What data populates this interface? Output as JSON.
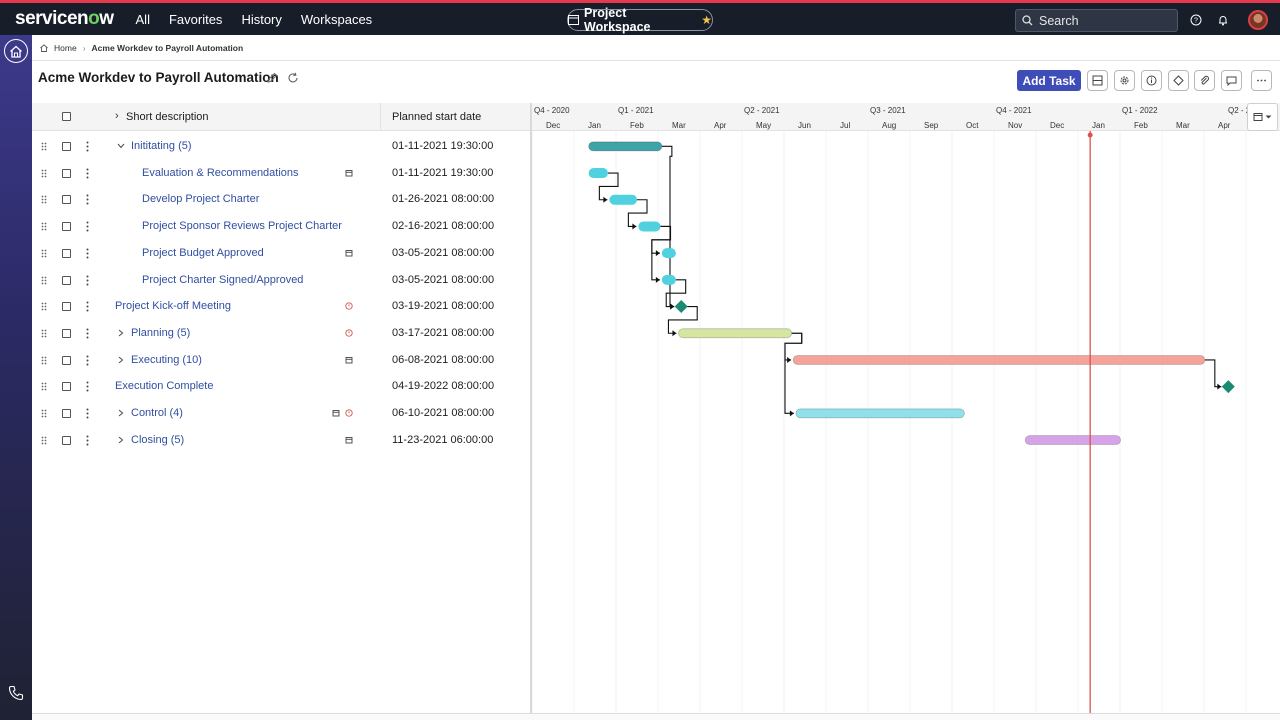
{
  "app": {
    "brand_pre": "servicen",
    "brand_o": "o",
    "brand_post": "w"
  },
  "nav": {
    "all": "All",
    "favorites": "Favorites",
    "history": "History",
    "workspaces": "Workspaces"
  },
  "workspace_pill": {
    "label": "Project Workspace"
  },
  "search": {
    "placeholder": "Search"
  },
  "breadcrumb": {
    "home": "Home",
    "current": "Acme Workdev to Payroll Automation"
  },
  "page": {
    "title": "Acme Workdev to Payroll Automation",
    "add_task": "Add Task"
  },
  "grid": {
    "col_description": "Short description",
    "col_start": "Planned start date",
    "rows": [
      {
        "label": "Inititating (5)",
        "date": "01-11-2021 19:30:00",
        "level": 1,
        "expander": "open",
        "indicators": []
      },
      {
        "label": "Evaluation & Recommendations",
        "date": "01-11-2021 19:30:00",
        "level": 2,
        "expander": "",
        "indicators": [
          "calendar"
        ]
      },
      {
        "label": "Develop Project Charter",
        "date": "01-26-2021 08:00:00",
        "level": 2,
        "expander": "",
        "indicators": []
      },
      {
        "label": "Project Sponsor Reviews Project Charter",
        "date": "02-16-2021 08:00:00",
        "level": 2,
        "expander": "",
        "indicators": []
      },
      {
        "label": "Project Budget Approved",
        "date": "03-05-2021 08:00:00",
        "level": 2,
        "expander": "",
        "indicators": [
          "calendar"
        ]
      },
      {
        "label": "Project Charter Signed/Approved",
        "date": "03-05-2021 08:00:00",
        "level": 2,
        "expander": "",
        "indicators": []
      },
      {
        "label": "Project Kick-off Meeting",
        "date": "03-19-2021 08:00:00",
        "level": 0,
        "expander": "",
        "indicators": [
          "alert"
        ]
      },
      {
        "label": "Planning (5)",
        "date": "03-17-2021 08:00:00",
        "level": 1,
        "expander": "closed",
        "indicators": [
          "alert"
        ]
      },
      {
        "label": "Executing (10)",
        "date": "06-08-2021 08:00:00",
        "level": 1,
        "expander": "closed",
        "indicators": [
          "calendar"
        ]
      },
      {
        "label": "Execution Complete",
        "date": "04-19-2022 08:00:00",
        "level": 0,
        "expander": "",
        "indicators": []
      },
      {
        "label": "Control (4)",
        "date": "06-10-2021 08:00:00",
        "level": 1,
        "expander": "closed",
        "indicators": [
          "calendar",
          "alert"
        ]
      },
      {
        "label": "Closing (5)",
        "date": "11-23-2021 06:00:00",
        "level": 1,
        "expander": "closed",
        "indicators": [
          "calendar"
        ]
      }
    ]
  },
  "timeline": {
    "quarters": [
      "Q4 - 2020",
      "Q1 - 2021",
      "Q2 - 2021",
      "Q3 - 2021",
      "Q4 - 2021",
      "Q1 - 2022",
      "Q2 - 2"
    ],
    "months": [
      "Dec",
      "Jan",
      "Feb",
      "Mar",
      "Apr",
      "May",
      "Jun",
      "Jul",
      "Aug",
      "Sep",
      "Oct",
      "Nov",
      "Dec",
      "Jan",
      "Feb",
      "Mar",
      "Apr"
    ],
    "today_color": "#d9534f",
    "bars": [
      {
        "row": 0,
        "type": "summary",
        "start": "2021-01-11",
        "end": "2021-03-05",
        "color": "#3fa3a8"
      },
      {
        "row": 1,
        "type": "task",
        "start": "2021-01-11",
        "end": "2021-01-25",
        "color": "#4fd1e0"
      },
      {
        "row": 2,
        "type": "task",
        "start": "2021-01-26",
        "end": "2021-02-15",
        "color": "#4fd1e0"
      },
      {
        "row": 3,
        "type": "task",
        "start": "2021-02-16",
        "end": "2021-03-04",
        "color": "#4fd1e0"
      },
      {
        "row": 4,
        "type": "task",
        "start": "2021-03-05",
        "end": "2021-03-15",
        "color": "#4fd1e0"
      },
      {
        "row": 5,
        "type": "task",
        "start": "2021-03-05",
        "end": "2021-03-15",
        "color": "#4fd1e0"
      },
      {
        "row": 6,
        "type": "milestone",
        "start": "2021-03-19",
        "color": "#1b8a72"
      },
      {
        "row": 7,
        "type": "summary",
        "start": "2021-03-17",
        "end": "2021-06-07",
        "color": "#d4e6a0"
      },
      {
        "row": 8,
        "type": "summary",
        "start": "2021-06-08",
        "end": "2022-04-02",
        "color": "#f4a29a"
      },
      {
        "row": 9,
        "type": "milestone",
        "start": "2022-04-19",
        "color": "#1b8a72"
      },
      {
        "row": 10,
        "type": "summary",
        "start": "2021-06-10",
        "end": "2021-10-10",
        "color": "#8fe0ea"
      },
      {
        "row": 11,
        "type": "summary",
        "start": "2021-11-23",
        "end": "2022-01-31",
        "color": "#d7a3e8"
      }
    ],
    "today": "2022-01-09"
  }
}
